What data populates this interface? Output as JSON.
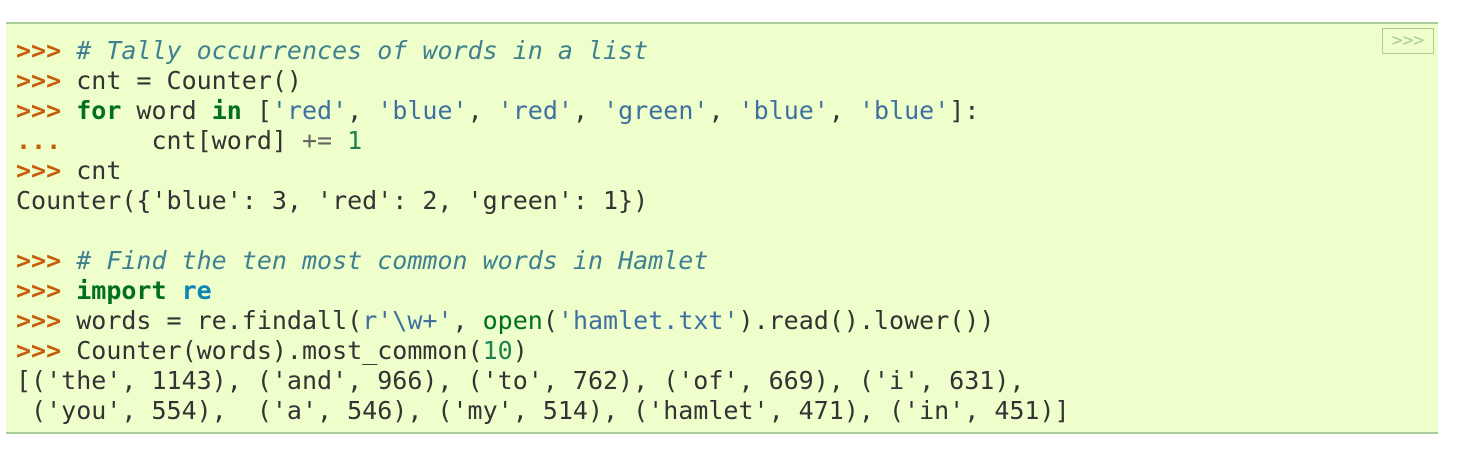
{
  "copy_button": {
    "label": ">>>"
  },
  "prompt": ">>>",
  "continuation": "...",
  "code": {
    "l1_comment": "# Tally occurrences of words in a list",
    "l2_text": "cnt = Counter()",
    "l3_for": "for",
    "l3_var": " word ",
    "l3_in": "in",
    "l3_list": [
      {
        "value": "'red'"
      },
      {
        "value": "'blue'"
      },
      {
        "value": "'red'"
      },
      {
        "value": "'green'"
      },
      {
        "value": "'blue'"
      },
      {
        "value": "'blue'"
      }
    ],
    "l4_target": "     cnt[word] ",
    "l4_op": "+=",
    "l4_num": "1",
    "l5_text": "cnt",
    "l6_output": "Counter({'blue': 3, 'red': 2, 'green': 1})",
    "l8_comment": "# Find the ten most common words in Hamlet",
    "l9_import": "import",
    "l9_module": "re",
    "l10_a": "words = re.findall(",
    "l10_raw": "r'\\w+'",
    "l10_open": "open",
    "l10_file": "'hamlet.txt'",
    "l10_b": ").read().lower())",
    "l11_a": "Counter(words).most_common(",
    "l11_num": "10",
    "l11_b": ")",
    "l12_output": "[('the', 1143), ('and', 966), ('to', 762), ('of', 669), ('i', 631),",
    "l13_output": " ('you', 554),  ('a', 546), ('my', 514), ('hamlet', 471), ('in', 451)]"
  }
}
